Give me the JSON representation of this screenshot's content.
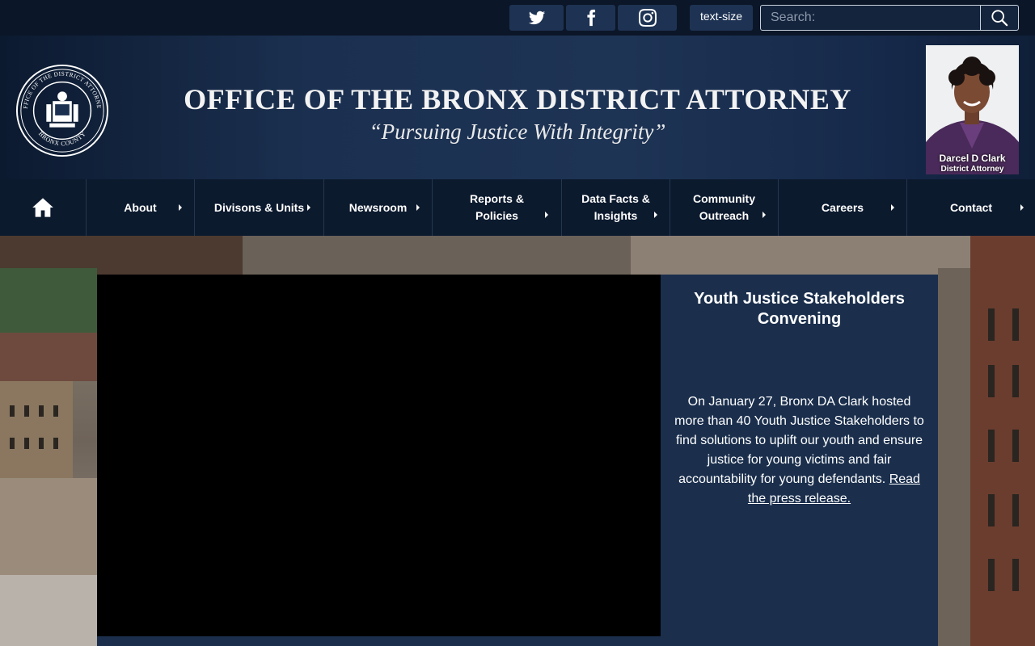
{
  "topbar": {
    "social": [
      {
        "name": "twitter",
        "icon": "twitter-icon"
      },
      {
        "name": "facebook",
        "icon": "facebook-icon"
      },
      {
        "name": "instagram",
        "icon": "instagram-icon"
      }
    ],
    "text_size_label": "text-size",
    "search": {
      "placeholder": "Search:",
      "value": "",
      "icon": "search-icon"
    }
  },
  "header": {
    "title": "OFFICE OF THE BRONX DISTRICT ATTORNEY",
    "tagline": "“Pursuing Justice With Integrity”",
    "seal_icon": "district-attorney-seal",
    "seal_text": "OFFICE OF THE DISTRICT ATTORNEY · BRONX COUNTY",
    "da": {
      "name": "Darcel D Clark",
      "role": "District Attorney"
    }
  },
  "nav": {
    "home_icon": "home-icon",
    "items": [
      {
        "label": "About"
      },
      {
        "label": "Divisons & Units"
      },
      {
        "label": "Newsroom"
      },
      {
        "label": "Reports & Policies"
      },
      {
        "label": "Data Facts & Insights"
      },
      {
        "label": "Community Outreach"
      },
      {
        "label": "Careers"
      },
      {
        "label": "Contact"
      }
    ]
  },
  "hero": {
    "story": {
      "title": "Youth Justice Stakeholders Convening",
      "body": "On January 27, Bronx DA Clark hosted more than 40  Youth Justice Stakeholders to find solutions to uplift our youth and ensure justice for young victims and fair accountability for young defendants. ",
      "link_text": "Read the press release."
    }
  },
  "colors": {
    "page_bg": "#0b1628",
    "header_bg": "#1e3455",
    "nav_bg": "#0c1a2e",
    "story_bg": "#1b2f4d",
    "button_bg": "#1e3353"
  }
}
